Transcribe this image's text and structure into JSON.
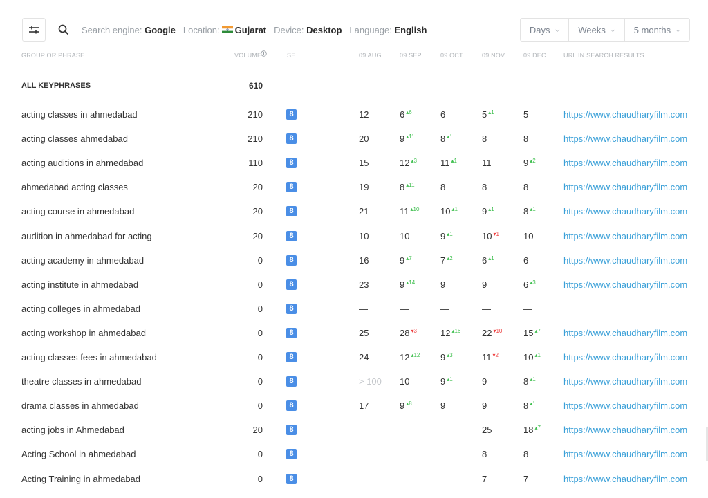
{
  "toolbar": {
    "filter_icon": "sliders-icon",
    "search_icon": "search-icon",
    "filters": [
      {
        "label": "Search engine:",
        "value": "Google"
      },
      {
        "label": "Location:",
        "value": "Gujarat"
      },
      {
        "label": "Device:",
        "value": "Desktop"
      },
      {
        "label": "Language:",
        "value": "English"
      }
    ],
    "periods": [
      "Days",
      "Weeks",
      "5 months"
    ]
  },
  "headers": {
    "phrase": "GROUP OR PHRASE",
    "volume": "VOLUME",
    "info_icon": "info-icon",
    "se": "SE",
    "dates": [
      "09 AUG",
      "09 SEP",
      "09 OCT",
      "09 NOV",
      "09 DEC"
    ],
    "url": "URL IN SEARCH RESULTS"
  },
  "all": {
    "label": "ALL KEYPHRASES",
    "volume": "610"
  },
  "rows": [
    {
      "phrase": "acting classes in ahmedabad",
      "volume": "210",
      "se": "8",
      "pos": [
        {
          "v": "12"
        },
        {
          "v": "6",
          "c": "6",
          "d": "up"
        },
        {
          "v": "6"
        },
        {
          "v": "5",
          "c": "1",
          "d": "up"
        },
        {
          "v": "5"
        }
      ],
      "url": "https://www.chaudharyfilm.com"
    },
    {
      "phrase": "acting classes ahmedabad",
      "volume": "210",
      "se": "8",
      "pos": [
        {
          "v": "20"
        },
        {
          "v": "9",
          "c": "11",
          "d": "up"
        },
        {
          "v": "8",
          "c": "1",
          "d": "up"
        },
        {
          "v": "8"
        },
        {
          "v": "8"
        }
      ],
      "url": "https://www.chaudharyfilm.com"
    },
    {
      "phrase": "acting auditions in ahmedabad",
      "volume": "110",
      "se": "8",
      "pos": [
        {
          "v": "15"
        },
        {
          "v": "12",
          "c": "3",
          "d": "up"
        },
        {
          "v": "11",
          "c": "1",
          "d": "up"
        },
        {
          "v": "11"
        },
        {
          "v": "9",
          "c": "2",
          "d": "up"
        }
      ],
      "url": "https://www.chaudharyfilm.com"
    },
    {
      "phrase": "ahmedabad acting classes",
      "volume": "20",
      "se": "8",
      "pos": [
        {
          "v": "19"
        },
        {
          "v": "8",
          "c": "11",
          "d": "up"
        },
        {
          "v": "8"
        },
        {
          "v": "8"
        },
        {
          "v": "8"
        }
      ],
      "url": "https://www.chaudharyfilm.com"
    },
    {
      "phrase": "acting course in ahmedabad",
      "volume": "20",
      "se": "8",
      "pos": [
        {
          "v": "21"
        },
        {
          "v": "11",
          "c": "10",
          "d": "up"
        },
        {
          "v": "10",
          "c": "1",
          "d": "up"
        },
        {
          "v": "9",
          "c": "1",
          "d": "up"
        },
        {
          "v": "8",
          "c": "1",
          "d": "up"
        }
      ],
      "url": "https://www.chaudharyfilm.com"
    },
    {
      "phrase": "audition in ahmedabad for acting",
      "volume": "20",
      "se": "8",
      "pos": [
        {
          "v": "10"
        },
        {
          "v": "10"
        },
        {
          "v": "9",
          "c": "1",
          "d": "up"
        },
        {
          "v": "10",
          "c": "1",
          "d": "down"
        },
        {
          "v": "10"
        }
      ],
      "url": "https://www.chaudharyfilm.com"
    },
    {
      "phrase": "acting academy in ahmedabad",
      "volume": "0",
      "se": "8",
      "pos": [
        {
          "v": "16"
        },
        {
          "v": "9",
          "c": "7",
          "d": "up"
        },
        {
          "v": "7",
          "c": "2",
          "d": "up"
        },
        {
          "v": "6",
          "c": "1",
          "d": "up"
        },
        {
          "v": "6"
        }
      ],
      "url": "https://www.chaudharyfilm.com"
    },
    {
      "phrase": "acting institute in ahmedabad",
      "volume": "0",
      "se": "8",
      "pos": [
        {
          "v": "23"
        },
        {
          "v": "9",
          "c": "14",
          "d": "up"
        },
        {
          "v": "9"
        },
        {
          "v": "9"
        },
        {
          "v": "6",
          "c": "3",
          "d": "up"
        }
      ],
      "url": "https://www.chaudharyfilm.com"
    },
    {
      "phrase": "acting colleges in ahmedabad",
      "volume": "0",
      "se": "8",
      "pos": [
        {
          "v": "—",
          "dash": true
        },
        {
          "v": "—",
          "dash": true
        },
        {
          "v": "—",
          "dash": true
        },
        {
          "v": "—",
          "dash": true
        },
        {
          "v": "—",
          "dash": true
        }
      ],
      "url": ""
    },
    {
      "phrase": "acting workshop in ahmedabad",
      "volume": "0",
      "se": "8",
      "pos": [
        {
          "v": "25"
        },
        {
          "v": "28",
          "c": "3",
          "d": "down"
        },
        {
          "v": "12",
          "c": "16",
          "d": "up"
        },
        {
          "v": "22",
          "c": "10",
          "d": "down"
        },
        {
          "v": "15",
          "c": "7",
          "d": "up"
        }
      ],
      "url": "https://www.chaudharyfilm.com"
    },
    {
      "phrase": "acting classes fees in ahmedabad",
      "volume": "0",
      "se": "8",
      "pos": [
        {
          "v": "24"
        },
        {
          "v": "12",
          "c": "12",
          "d": "up"
        },
        {
          "v": "9",
          "c": "3",
          "d": "up"
        },
        {
          "v": "11",
          "c": "2",
          "d": "down"
        },
        {
          "v": "10",
          "c": "1",
          "d": "up"
        }
      ],
      "url": "https://www.chaudharyfilm.com"
    },
    {
      "phrase": "theatre classes in ahmedabad",
      "volume": "0",
      "se": "8",
      "pos": [
        {
          "v": "> 100",
          "muted": true
        },
        {
          "v": "10"
        },
        {
          "v": "9",
          "c": "1",
          "d": "up"
        },
        {
          "v": "9"
        },
        {
          "v": "8",
          "c": "1",
          "d": "up"
        }
      ],
      "url": "https://www.chaudharyfilm.com"
    },
    {
      "phrase": "drama classes in ahmedabad",
      "volume": "0",
      "se": "8",
      "pos": [
        {
          "v": "17"
        },
        {
          "v": "9",
          "c": "8",
          "d": "up"
        },
        {
          "v": "9"
        },
        {
          "v": "9"
        },
        {
          "v": "8",
          "c": "1",
          "d": "up"
        }
      ],
      "url": "https://www.chaudharyfilm.com"
    },
    {
      "phrase": "acting jobs in Ahmedabad",
      "volume": "20",
      "se": "8",
      "pos": [
        {
          "v": ""
        },
        {
          "v": ""
        },
        {
          "v": ""
        },
        {
          "v": "25"
        },
        {
          "v": "18",
          "c": "7",
          "d": "up"
        }
      ],
      "url": "https://www.chaudharyfilm.com"
    },
    {
      "phrase": "Acting School in ahmedabad",
      "volume": "0",
      "se": "8",
      "pos": [
        {
          "v": ""
        },
        {
          "v": ""
        },
        {
          "v": ""
        },
        {
          "v": "8"
        },
        {
          "v": "8"
        }
      ],
      "url": "https://www.chaudharyfilm.com"
    },
    {
      "phrase": "Acting Training in ahmedabad",
      "volume": "0",
      "se": "8",
      "pos": [
        {
          "v": ""
        },
        {
          "v": ""
        },
        {
          "v": ""
        },
        {
          "v": "7"
        },
        {
          "v": "7"
        }
      ],
      "url": "https://www.chaudharyfilm.com"
    }
  ]
}
